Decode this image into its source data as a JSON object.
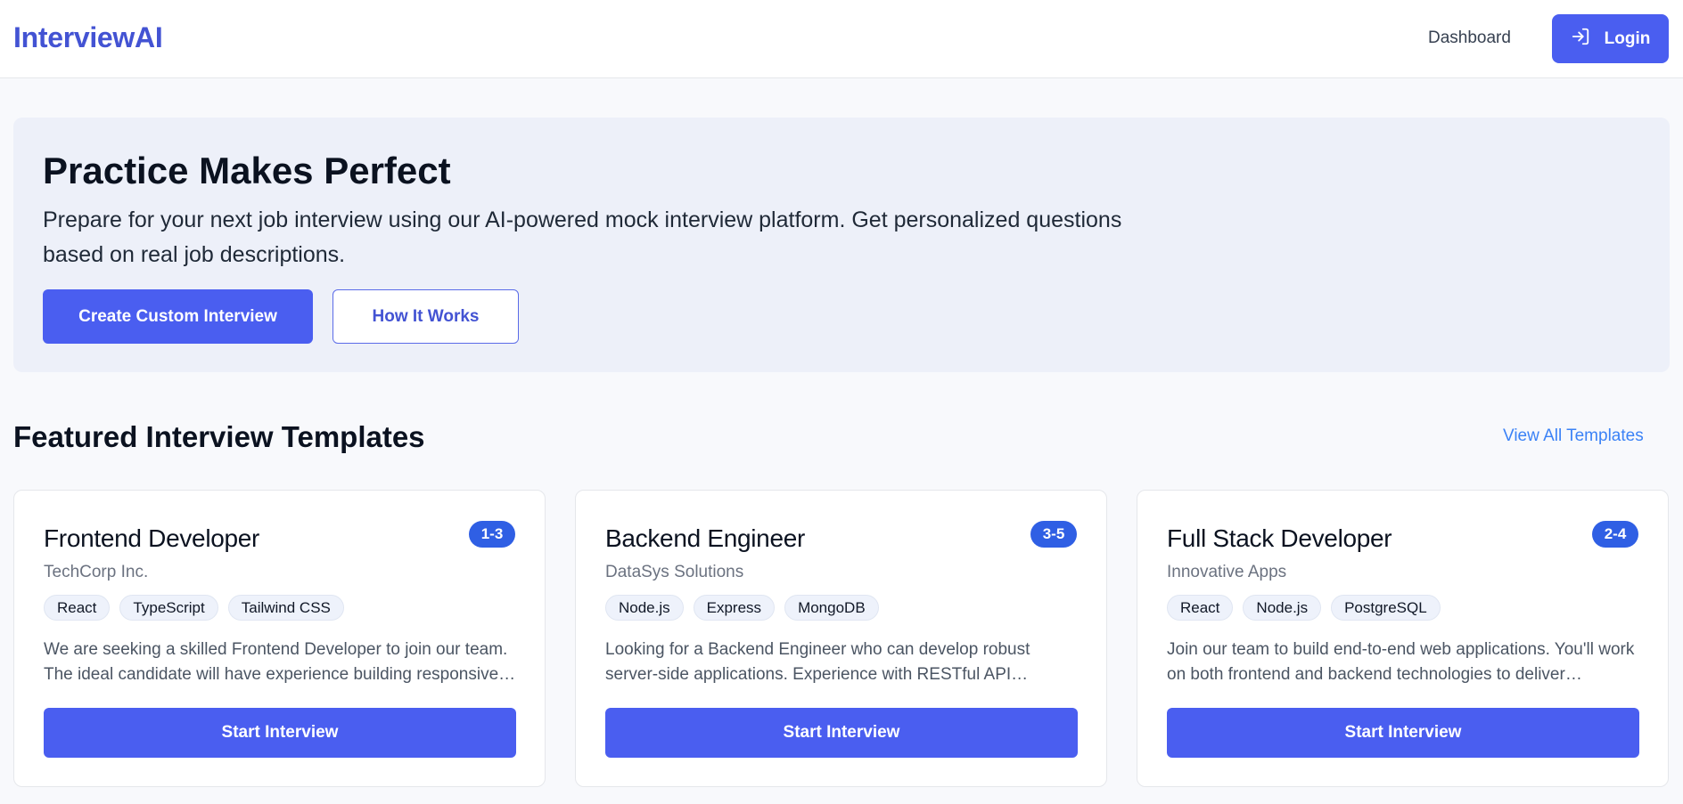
{
  "app": {
    "brand": "InterviewAI"
  },
  "nav": {
    "dashboard": "Dashboard",
    "login": "Login"
  },
  "hero": {
    "title": "Practice Makes Perfect",
    "description": "Prepare for your next job interview using our AI-powered mock interview platform. Get personalized questions based on real job descriptions.",
    "primary_button": "Create Custom Interview",
    "secondary_button": "How It Works"
  },
  "featured": {
    "title": "Featured Interview Templates",
    "view_all": "View All Templates",
    "cards": [
      {
        "title": "Frontend Developer",
        "badge": "1-3",
        "company": "TechCorp Inc.",
        "tags": [
          "React",
          "TypeScript",
          "Tailwind CSS"
        ],
        "description": "We are seeking a skilled Frontend Developer to join our team. The ideal candidate will have experience building responsive…",
        "button": "Start Interview"
      },
      {
        "title": "Backend Engineer",
        "badge": "3-5",
        "company": "DataSys Solutions",
        "tags": [
          "Node.js",
          "Express",
          "MongoDB"
        ],
        "description": "Looking for a Backend Engineer who can develop robust server-side applications. Experience with RESTful API design…",
        "button": "Start Interview"
      },
      {
        "title": "Full Stack Developer",
        "badge": "2-4",
        "company": "Innovative Apps",
        "tags": [
          "React",
          "Node.js",
          "PostgreSQL"
        ],
        "description": "Join our team to build end-to-end web applications. You'll work on both frontend and backend technologies to deliver…",
        "button": "Start Interview"
      }
    ]
  },
  "colors": {
    "brand": "#4353d3",
    "primary": "#4a5ef0",
    "badge": "#2f5fe4",
    "link": "#3b82f6",
    "hero_bg": "#edf0f9"
  },
  "icons": {
    "login": "login-arrow-icon"
  }
}
